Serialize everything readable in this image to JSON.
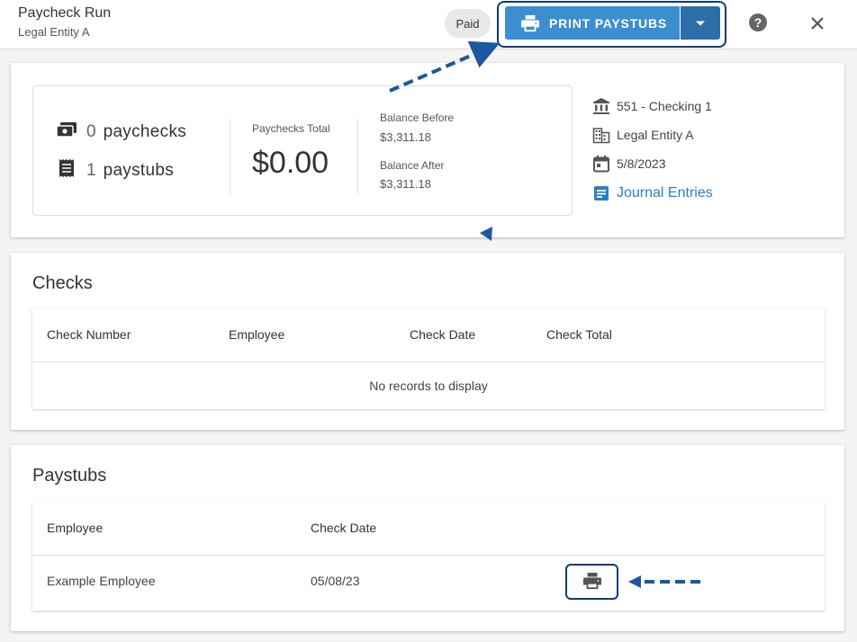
{
  "header": {
    "title": "Paycheck Run",
    "subtitle": "Legal Entity A",
    "status_badge": "Paid",
    "print_button_label": "PRINT PAYSTUBS"
  },
  "summary": {
    "paychecks_count": "0",
    "paychecks_label": "paychecks",
    "paystubs_count": "1",
    "paystubs_label": "paystubs",
    "paychecks_total_label": "Paychecks Total",
    "paychecks_total_value": "$0.00",
    "balance_before_label": "Balance Before",
    "balance_before_value": "$3,311.18",
    "balance_after_label": "Balance After",
    "balance_after_value": "$3,311.18"
  },
  "info": {
    "account": "551 - Checking 1",
    "entity": "Legal Entity A",
    "date": "5/8/2023",
    "journal_link": "Journal Entries"
  },
  "checks": {
    "title": "Checks",
    "columns": [
      "Check Number",
      "Employee",
      "Check Date",
      "Check Total"
    ],
    "empty_message": "No records to display"
  },
  "paystubs": {
    "title": "Paystubs",
    "columns": [
      "Employee",
      "Check Date"
    ],
    "rows": [
      {
        "employee": "Example Employee",
        "check_date": "05/08/23"
      }
    ]
  },
  "colors": {
    "primary_button": "#3b8fd0",
    "primary_button_dark": "#2c6ea8",
    "highlight_border": "#0f3a7a",
    "link": "#2c7fc0"
  },
  "icons": {
    "print": "print-icon",
    "dropdown": "caret-down-icon",
    "help": "help-circle-icon",
    "close": "close-icon",
    "paychecks": "money-icon",
    "paystubs": "receipt-icon",
    "bank": "bank-icon",
    "entity": "building-icon",
    "date": "calendar-icon",
    "journal": "journal-icon"
  }
}
